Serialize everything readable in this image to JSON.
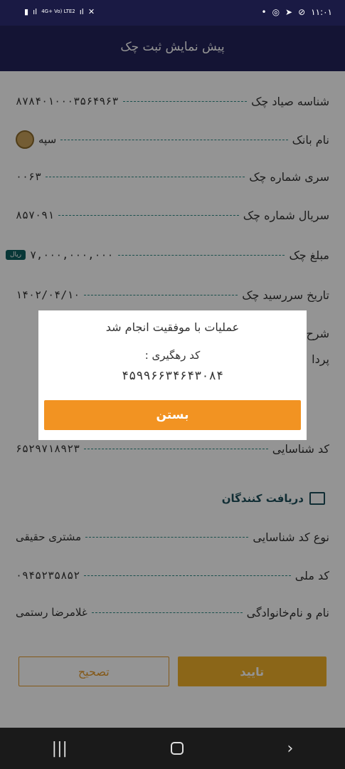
{
  "status_bar": {
    "time": "۱۱:۰۱",
    "network": "4G+ Vo) LTE2",
    "icons": [
      "battery-icon",
      "signal-icon",
      "mute-icon",
      "whatsapp-icon",
      "telegram-icon",
      "send-icon",
      "dot-icon"
    ]
  },
  "header": {
    "title": "پیش نمایش ثبت چک"
  },
  "cheque": {
    "sayad_id": {
      "label": "شناسه صیاد چک",
      "value": "۸۷۸۴۰۱۰۰۰۳۵۶۴۹۶۳"
    },
    "bank_name": {
      "label": "نام بانک",
      "value": "سپه"
    },
    "series": {
      "label": "سری شماره چک",
      "value": "۰۰۶۳"
    },
    "serial": {
      "label": "سریال شماره چک",
      "value": "۸۵۷۰۹۱"
    },
    "amount": {
      "label": "مبلغ چک",
      "value": "۷,۰۰۰,۰۰۰,۰۰۰",
      "currency": "ریال"
    },
    "due_date": {
      "label": "تاریخ سررسید چک",
      "value": "۱۴۰۲/۰۴/۱۰"
    },
    "description_label_partial": "شرح",
    "payer_label_partial": "پردا"
  },
  "issuer": {
    "id_code": {
      "label": "کد شناسایی",
      "value": "۶۵۲۹۷۱۸۹۲۳"
    }
  },
  "receivers": {
    "section_title": "دریافت کنندگان",
    "id_type": {
      "label": "نوع کد شناسایی",
      "value": "مشتری حقیقی"
    },
    "national_code": {
      "label": "کد ملی",
      "value": "۰۹۴۵۲۳۵۸۵۲"
    },
    "full_name": {
      "label": "نام و نام‌خانوادگی",
      "value": "غلامرضا رستمی"
    }
  },
  "buttons": {
    "confirm": "تایید",
    "edit": "تصحیح"
  },
  "dialog": {
    "message": "عملیات با موفقیت انجام شد",
    "tracking_label": "کد رهگیری :",
    "tracking_code": "۴۵۹۹۶۶۳۴۶۴۳۰۸۴",
    "close": "بستن"
  },
  "colors": {
    "header": "#24245a",
    "accent": "#f29322",
    "teal": "#0f5f5f"
  }
}
